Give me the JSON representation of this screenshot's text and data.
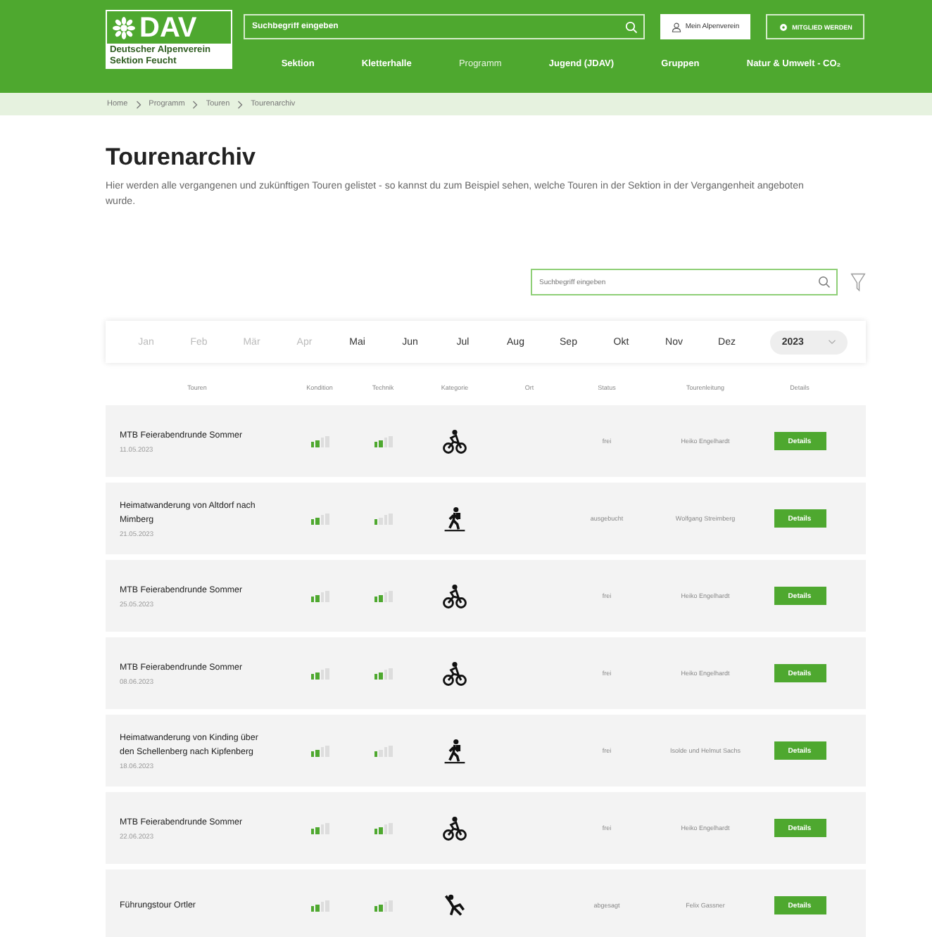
{
  "header": {
    "logo": {
      "mark": "DAV",
      "name": "Deutscher Alpenverein",
      "section": "Sektion Feucht"
    },
    "search": {
      "placeholder": "Suchbegriff eingeben"
    },
    "account_button": "Mein Alpenverein",
    "join_button": "MITGLIED WERDEN",
    "nav": [
      {
        "label": "Sektion",
        "selected": false
      },
      {
        "label": "Kletterhalle",
        "selected": false
      },
      {
        "label": "Programm",
        "selected": true
      },
      {
        "label": "Jugend (JDAV)",
        "selected": false
      },
      {
        "label": "Gruppen",
        "selected": false
      },
      {
        "label": "Natur & Umwelt - CO₂",
        "selected": false
      }
    ]
  },
  "breadcrumb": [
    "Home",
    "Programm",
    "Touren",
    "Tourenarchiv"
  ],
  "title": "Tourenarchiv",
  "description": "Hier werden alle vergangenen und zukünftigen Touren gelistet - so kannst du zum Beispiel sehen, welche Touren in der Sektion in der Vergangenheit angeboten wurde.",
  "search": {
    "placeholder": "Suchbegriff eingeben"
  },
  "months": [
    {
      "label": "Jan",
      "disabled": true
    },
    {
      "label": "Feb",
      "disabled": true
    },
    {
      "label": "Mär",
      "disabled": true
    },
    {
      "label": "Apr",
      "disabled": true
    },
    {
      "label": "Mai",
      "disabled": false
    },
    {
      "label": "Jun",
      "disabled": false
    },
    {
      "label": "Jul",
      "disabled": false
    },
    {
      "label": "Aug",
      "disabled": false
    },
    {
      "label": "Sep",
      "disabled": false
    },
    {
      "label": "Okt",
      "disabled": false
    },
    {
      "label": "Nov",
      "disabled": false
    },
    {
      "label": "Dez",
      "disabled": false
    }
  ],
  "year": "2023",
  "table": {
    "columns": [
      "Touren",
      "Kondition",
      "Technik",
      "Kategorie",
      "Ort",
      "Status",
      "Tourenleitung",
      "Details"
    ],
    "rows": [
      {
        "title": "MTB Feierabendrunde Sommer",
        "date": "11.05.2023",
        "kondition": {
          "level": 0.5
        },
        "technik": {
          "level": 0.5
        },
        "category": {
          "kind": "bike"
        },
        "status": "frei",
        "leader": "Heiko Engelhardt",
        "button": "Details"
      },
      {
        "title": "Heimatwanderung von Altdorf nach Mimberg",
        "date": "21.05.2023",
        "kondition": {
          "level": 0.5
        },
        "technik": {
          "level": 0.25
        },
        "category": {
          "kind": "hike"
        },
        "status": "ausgebucht",
        "leader": "Wolfgang Streimberg",
        "button": "Details"
      },
      {
        "title": "MTB Feierabendrunde Sommer",
        "date": "25.05.2023",
        "kondition": {
          "level": 0.5
        },
        "technik": {
          "level": 0.5
        },
        "category": {
          "kind": "bike"
        },
        "status": "frei",
        "leader": "Heiko Engelhardt",
        "button": "Details"
      },
      {
        "title": "MTB Feierabendrunde Sommer",
        "date": "08.06.2023",
        "kondition": {
          "level": 0.5
        },
        "technik": {
          "level": 0.5
        },
        "category": {
          "kind": "bike"
        },
        "status": "frei",
        "leader": "Heiko Engelhardt",
        "button": "Details"
      },
      {
        "title": "Heimatwanderung von Kinding über den Schellenberg nach Kipfenberg",
        "date": "18.06.2023",
        "kondition": {
          "level": 0.5
        },
        "technik": {
          "level": 0.25
        },
        "category": {
          "kind": "hike"
        },
        "status": "frei",
        "leader": "Isolde und Helmut Sachs",
        "button": "Details"
      },
      {
        "title": "MTB Feierabendrunde Sommer",
        "date": "22.06.2023",
        "kondition": {
          "level": 0.5
        },
        "technik": {
          "level": 0.5
        },
        "category": {
          "kind": "bike"
        },
        "status": "frei",
        "leader": "Heiko Engelhardt",
        "button": "Details"
      },
      {
        "title": "Führungstour Ortler",
        "kondition": {
          "level": 0.5
        },
        "technik": {
          "level": 0.5
        },
        "category": {
          "kind": "climb"
        },
        "status": "abgesagt",
        "leader": "Felix Gassner",
        "button": "Details"
      }
    ]
  }
}
